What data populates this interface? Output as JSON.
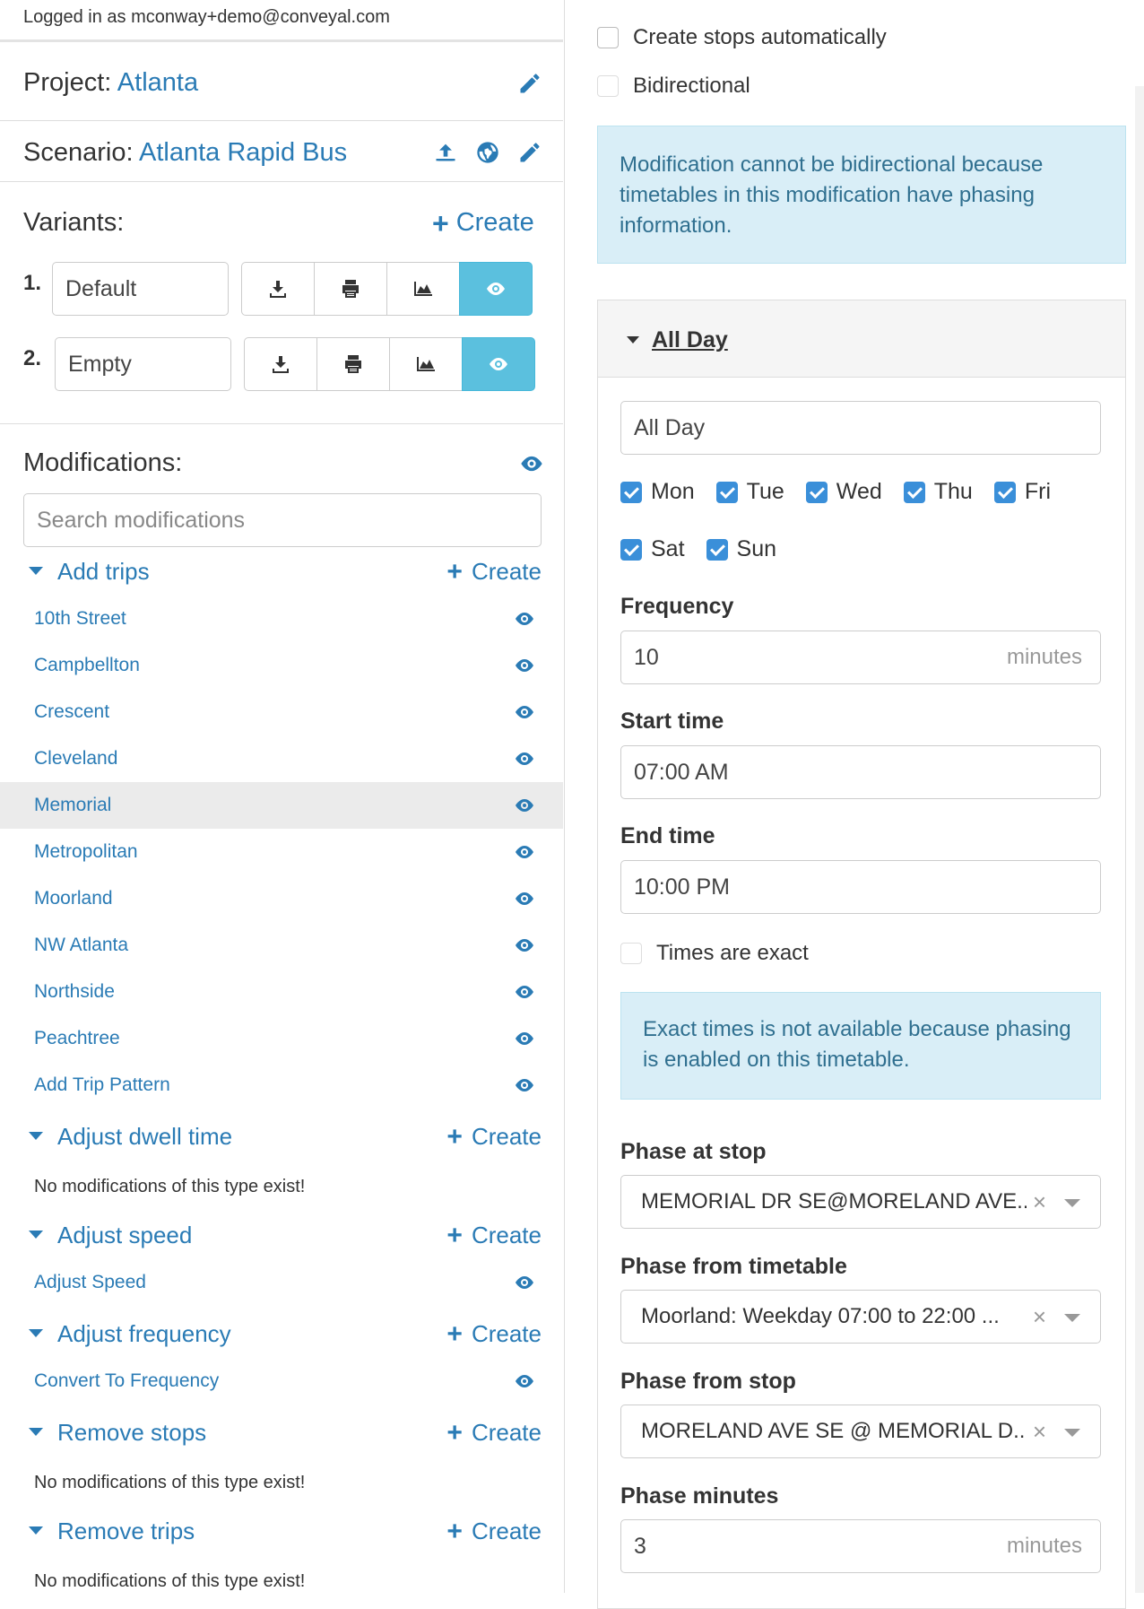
{
  "header": {
    "logged_in": "Logged in as mconway+demo@conveyal.com"
  },
  "project": {
    "label": "Project:",
    "name": "Atlanta"
  },
  "scenario": {
    "label": "Scenario:",
    "name": "Atlanta Rapid Bus"
  },
  "variants": {
    "label": "Variants:",
    "create_label": "Create",
    "items": [
      {
        "num": "1.",
        "name": "Default"
      },
      {
        "num": "2.",
        "name": "Empty"
      }
    ]
  },
  "modifications": {
    "label": "Modifications:",
    "search_placeholder": "Search modifications",
    "create_label": "Create",
    "none_text": "No modifications of this type exist!",
    "groups": [
      {
        "label": "Add trips",
        "items": [
          "10th Street",
          "Campbellton",
          "Crescent",
          "Cleveland",
          "Memorial",
          "Metropolitan",
          "Moorland",
          "NW Atlanta",
          "Northside",
          "Peachtree",
          "Add Trip Pattern"
        ]
      },
      {
        "label": "Adjust dwell time",
        "items": []
      },
      {
        "label": "Adjust speed",
        "items": [
          "Adjust Speed"
        ]
      },
      {
        "label": "Adjust frequency",
        "items": [
          "Convert To Frequency"
        ]
      },
      {
        "label": "Remove stops",
        "items": []
      },
      {
        "label": "Remove trips",
        "items": []
      }
    ],
    "active_item": "Memorial"
  },
  "right": {
    "create_stops": "Create stops automatically",
    "bidirectional": "Bidirectional",
    "bidirectional_alert": "Modification cannot be bidirectional because timetables in this modification have phasing information.",
    "timetable": {
      "title": "All Day",
      "name_value": "All Day",
      "days": [
        {
          "label": "Mon",
          "checked": true
        },
        {
          "label": "Tue",
          "checked": true
        },
        {
          "label": "Wed",
          "checked": true
        },
        {
          "label": "Thu",
          "checked": true
        },
        {
          "label": "Fri",
          "checked": true
        },
        {
          "label": "Sat",
          "checked": true
        },
        {
          "label": "Sun",
          "checked": true
        }
      ],
      "frequency_label": "Frequency",
      "frequency_value": "10",
      "minutes_unit": "minutes",
      "start_label": "Start time",
      "start_value": "07:00  AM",
      "end_label": "End time",
      "end_value": "10:00  PM",
      "exact_label": "Times are exact",
      "exact_alert": "Exact times is not available because phasing is enabled on this timetable.",
      "phase_stop_label": "Phase at stop",
      "phase_stop_value": "MEMORIAL DR SE@MORELAND AVE...",
      "phase_timetable_label": "Phase from timetable",
      "phase_timetable_value": "Moorland: Weekday 07:00 to 22:00 ...",
      "phase_from_stop_label": "Phase from stop",
      "phase_from_stop_value": "MORELAND AVE SE @ MEMORIAL D...",
      "phase_minutes_label": "Phase minutes",
      "phase_minutes_value": "3"
    }
  },
  "colors": {
    "link": "#2a7bb5",
    "active_button": "#5bc0de",
    "alert_bg": "#d9eef7",
    "checkbox": "#3a8fd9"
  }
}
